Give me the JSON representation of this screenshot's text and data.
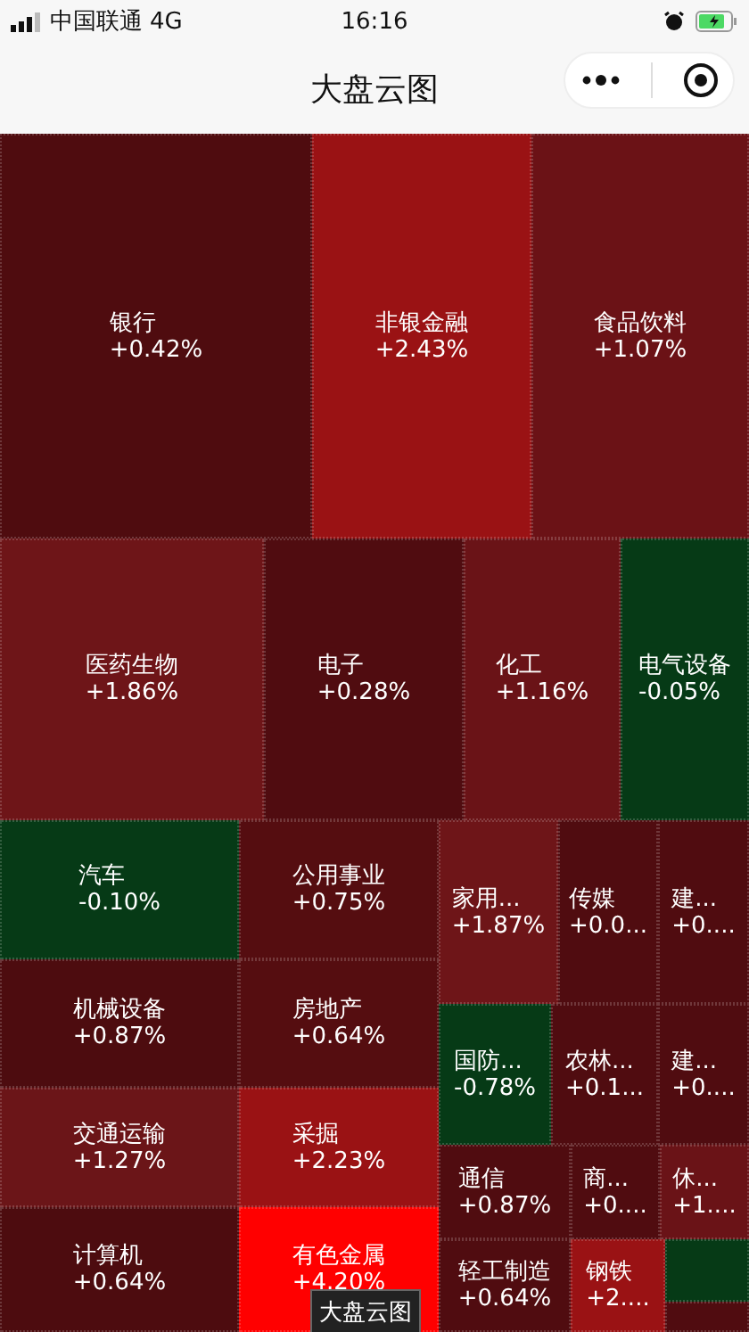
{
  "status_bar": {
    "carrier": "中国联通",
    "network": "4G",
    "time": "16:16"
  },
  "nav": {
    "title": "大盘云图"
  },
  "treemap": {
    "cells": [
      {
        "name": "银行",
        "change": "+0.42%",
        "color": "#4f0c0f"
      },
      {
        "name": "非银金融",
        "change": "+2.43%",
        "color": "#9a1214"
      },
      {
        "name": "食品饮料",
        "change": "+1.07%",
        "color": "#6b1216"
      },
      {
        "name": "医药生物",
        "change": "+1.86%",
        "color": "#6e1518"
      },
      {
        "name": "电子",
        "change": "+0.28%",
        "color": "#500c10"
      },
      {
        "name": "化工",
        "change": "+1.16%",
        "color": "#6a1317"
      },
      {
        "name": "电气设备",
        "change": "-0.05%",
        "color": "#063a16"
      },
      {
        "name": "汽车",
        "change": "-0.10%",
        "color": "#063a16"
      },
      {
        "name": "公用事业",
        "change": "+0.75%",
        "color": "#550d10"
      },
      {
        "name": "机械设备",
        "change": "+0.87%",
        "color": "#4d0c0f"
      },
      {
        "name": "房地产",
        "change": "+0.64%",
        "color": "#550d10"
      },
      {
        "name": "交通运输",
        "change": "+1.27%",
        "color": "#6b1518"
      },
      {
        "name": "采掘",
        "change": "+2.23%",
        "color": "#9a1214"
      },
      {
        "name": "计算机",
        "change": "+0.64%",
        "color": "#4d0c0f"
      },
      {
        "name": "有色金属",
        "change": "+4.20%",
        "color": "#ff0000"
      },
      {
        "name": "家用...",
        "change": "+1.87%",
        "color": "#6e1518"
      },
      {
        "name": "传媒",
        "change": "+0.0...",
        "color": "#500c10"
      },
      {
        "name": "建...",
        "change": "+0....",
        "color": "#500c10"
      },
      {
        "name": "国防...",
        "change": "-0.78%",
        "color": "#063a16"
      },
      {
        "name": "农林...",
        "change": "+0.1...",
        "color": "#500c10"
      },
      {
        "name": "建...",
        "change": "+0....",
        "color": "#500c10"
      },
      {
        "name": "通信",
        "change": "+0.87%",
        "color": "#500c10"
      },
      {
        "name": "商...",
        "change": "+0....",
        "color": "#500c10"
      },
      {
        "name": "休...",
        "change": "+1....",
        "color": "#6a1317"
      },
      {
        "name": "轻工制造",
        "change": "+0.64%",
        "color": "#500c10"
      },
      {
        "name": "钢铁",
        "change": "+2....",
        "color": "#9a1214"
      },
      {
        "color": "#063a16"
      },
      {
        "color": "#500c10"
      }
    ]
  },
  "tooltip": {
    "text": "大盘云图"
  }
}
